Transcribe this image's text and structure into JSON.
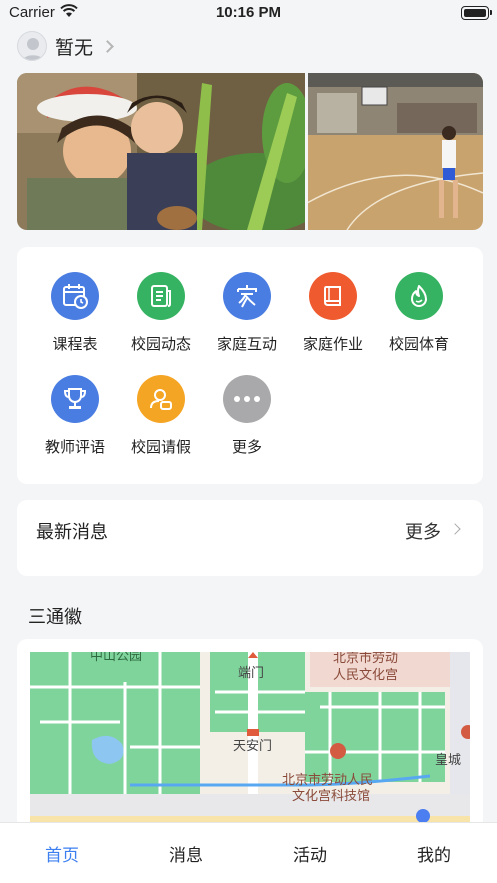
{
  "status_bar": {
    "carrier": "Carrier",
    "time": "10:16 PM"
  },
  "user": {
    "name": "暂无"
  },
  "grid": {
    "items": [
      {
        "label": "课程表",
        "color": "#4a7de2",
        "icon": "calendar-clock-icon"
      },
      {
        "label": "校园动态",
        "color": "#36b362",
        "icon": "news-icon"
      },
      {
        "label": "家庭互动",
        "color": "#4a7de2",
        "icon": "home-character-icon"
      },
      {
        "label": "家庭作业",
        "color": "#ef5a2e",
        "icon": "book-icon"
      },
      {
        "label": "校园体育",
        "color": "#36b362",
        "icon": "flame-icon"
      },
      {
        "label": "教师评语",
        "color": "#4a7de2",
        "icon": "trophy-icon"
      },
      {
        "label": "校园请假",
        "color": "#f5a524",
        "icon": "person-leave-icon"
      },
      {
        "label": "更多",
        "color": "#a9a9ab",
        "icon": "more-dots-icon"
      }
    ]
  },
  "news": {
    "title": "最新消息",
    "more": "更多"
  },
  "section": {
    "title": "三通徽"
  },
  "map": {
    "labels": {
      "park": "中山公园",
      "gate": "端门",
      "palace_top_1": "北京市劳动",
      "palace_top_2": "人民文化宫",
      "tiananmen": "天安门",
      "palace_1": "北京市劳动人民",
      "palace_2": "文化宫科技馆",
      "imperial": "皇城"
    }
  },
  "tabbar": {
    "tabs": [
      {
        "label": "首页",
        "active": true
      },
      {
        "label": "消息",
        "active": false
      },
      {
        "label": "活动",
        "active": false
      },
      {
        "label": "我的",
        "active": false
      }
    ],
    "active_color": "#3d7ff0"
  }
}
